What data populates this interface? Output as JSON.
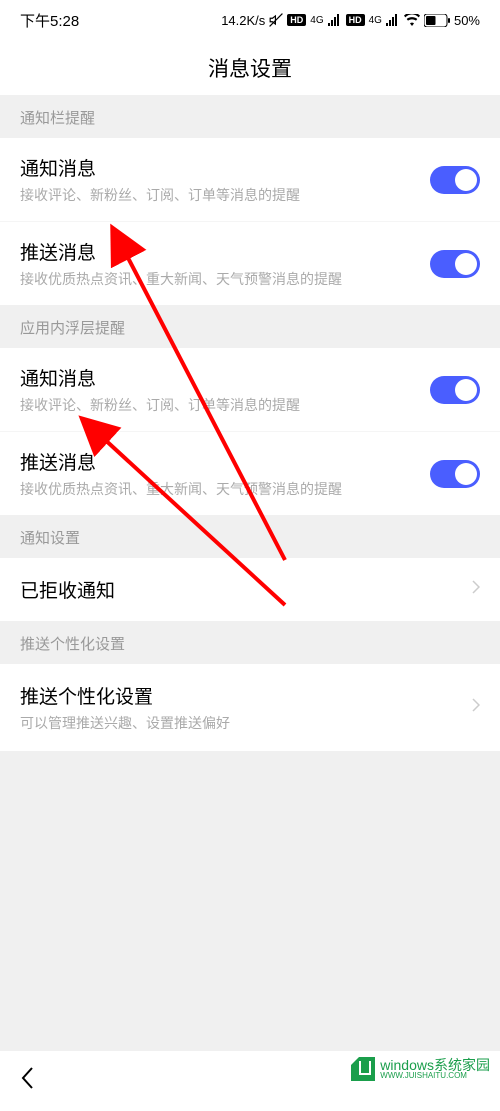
{
  "statusBar": {
    "time": "下午5:28",
    "speed": "14.2K/s",
    "network4g": "4G",
    "hd": "HD",
    "battery": "50%"
  },
  "pageTitle": "消息设置",
  "sections": {
    "notificationBar": {
      "header": "通知栏提醒",
      "items": [
        {
          "title": "通知消息",
          "desc": "接收评论、新粉丝、订阅、订单等消息的提醒",
          "on": true
        },
        {
          "title": "推送消息",
          "desc": "接收优质热点资讯、重大新闻、天气预警消息的提醒",
          "on": true
        }
      ]
    },
    "inApp": {
      "header": "应用内浮层提醒",
      "items": [
        {
          "title": "通知消息",
          "desc": "接收评论、新粉丝、订阅、订单等消息的提醒",
          "on": true
        },
        {
          "title": "推送消息",
          "desc": "接收优质热点资讯、重大新闻、天气预警消息的提醒",
          "on": true
        }
      ]
    },
    "notificationSettings": {
      "header": "通知设置",
      "item": {
        "title": "已拒收通知"
      }
    },
    "personalization": {
      "header": "推送个性化设置",
      "item": {
        "title": "推送个性化设置",
        "desc": "可以管理推送兴趣、设置推送偏好"
      }
    }
  },
  "watermark": {
    "top": "windows系统家园",
    "bottom": "WWW.JUISHAITU.COM"
  }
}
